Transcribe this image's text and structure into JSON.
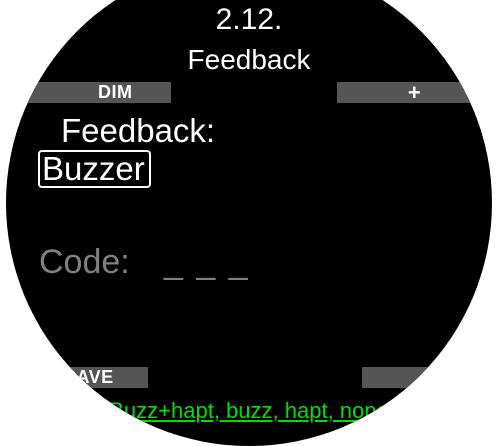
{
  "header": {
    "menu_number": "2.12.",
    "title": "Feedback"
  },
  "softkeys": {
    "top_left": "DIM",
    "top_right": "+",
    "bottom_left": "SAVE",
    "bottom_right": "−"
  },
  "feedback": {
    "label": "Feedback:",
    "value": "Buzzer"
  },
  "code": {
    "label": "Code:",
    "value": "_ _ _"
  },
  "hint": "Buzz+hapt, buzz, hapt, none",
  "colors": {
    "background": "#000000",
    "text": "#ffffff",
    "disabled_text": "#808080",
    "softkey_bar": "#555555",
    "hint_text": "#00e000"
  }
}
